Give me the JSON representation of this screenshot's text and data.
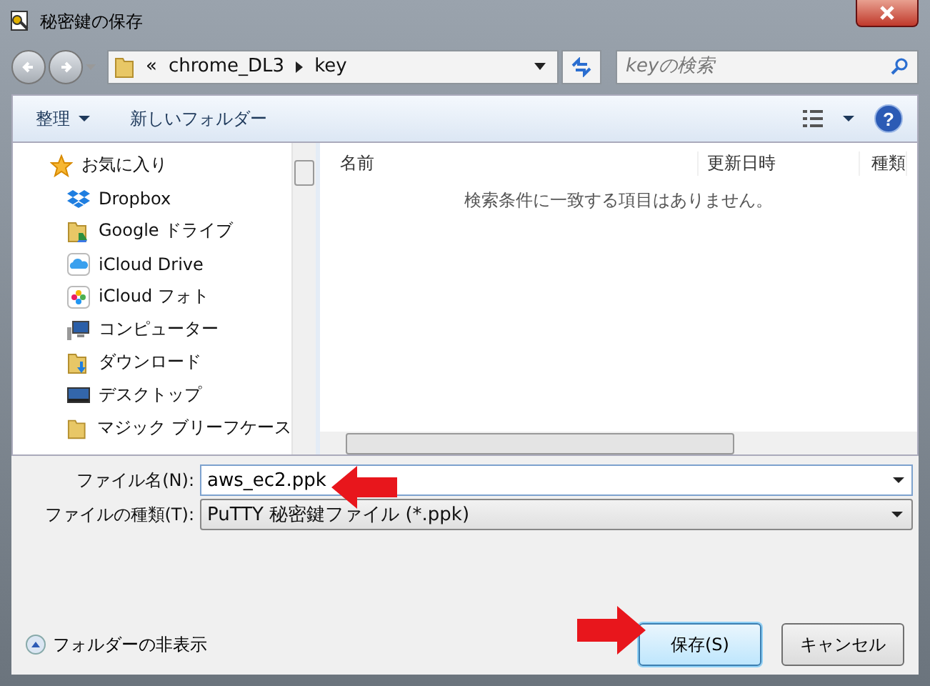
{
  "window": {
    "title": "秘密鍵の保存"
  },
  "address_bar": {
    "overflow": "«",
    "path": [
      "chrome_DL3",
      "key"
    ]
  },
  "search": {
    "placeholder": "keyの検索"
  },
  "toolbar": {
    "organize": "整理",
    "new_folder": "新しいフォルダー",
    "help": "?"
  },
  "sidebar": {
    "items": [
      {
        "label": "お気に入り",
        "kind": "star"
      },
      {
        "label": "Dropbox",
        "kind": "dropbox"
      },
      {
        "label": "Google ドライブ",
        "kind": "gdrive"
      },
      {
        "label": "iCloud Drive",
        "kind": "icloud"
      },
      {
        "label": "iCloud フォト",
        "kind": "photos"
      },
      {
        "label": "コンピューター",
        "kind": "computer"
      },
      {
        "label": "ダウンロード",
        "kind": "download"
      },
      {
        "label": "デスクトップ",
        "kind": "desktop"
      },
      {
        "label": "マジック ブリーフケース",
        "kind": "folder"
      }
    ]
  },
  "file_list": {
    "columns": [
      "名前",
      "更新日時",
      "種類"
    ],
    "empty_message": "検索条件に一致する項目はありません。"
  },
  "fields": [
    {
      "label": "ファイル名(N):",
      "value": "aws_ec2.ppk",
      "kind": "input"
    },
    {
      "label": "ファイルの種類(T):",
      "value": "PuTTY 秘密鍵ファイル (*.ppk)",
      "kind": "select"
    }
  ],
  "hide_folders": "フォルダーの非表示",
  "buttons": [
    {
      "label": "保存(S)",
      "default": true
    },
    {
      "label": "キャンセル",
      "default": false
    }
  ]
}
